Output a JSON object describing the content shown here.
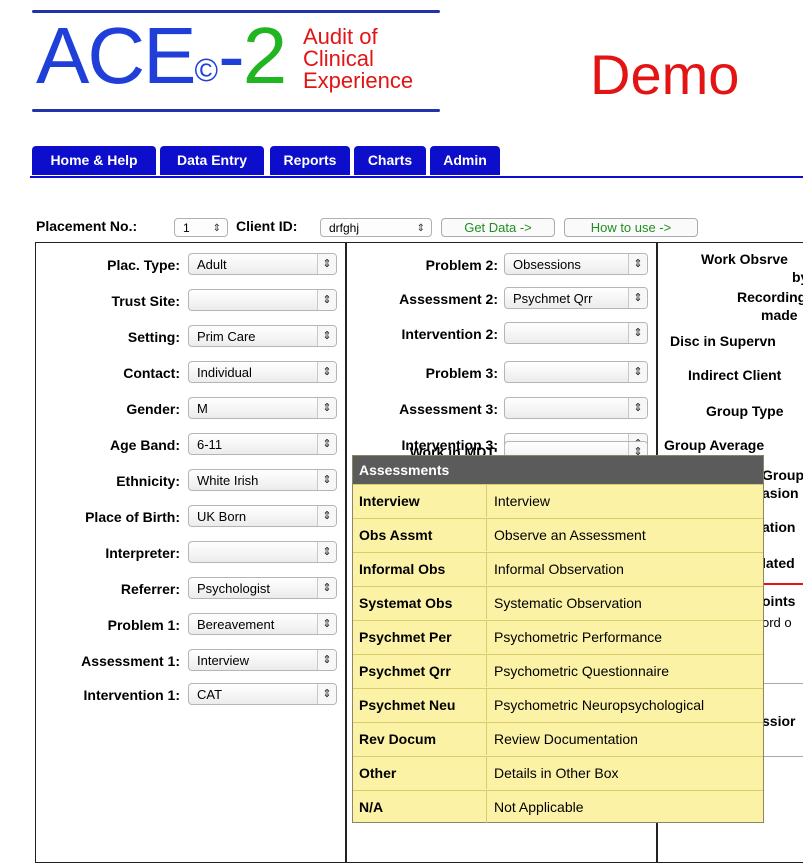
{
  "header": {
    "logo_main": "ACE",
    "logo_copyright": "©",
    "logo_dash": "-",
    "logo_number": "2",
    "logo_tagline": [
      "Audit of",
      "Clinical",
      "Experience"
    ],
    "demo_label": "Demo",
    "colors": {
      "blue": "#1f3fd8",
      "green": "#22b522",
      "red": "#e21414",
      "nav": "#0d0dcc"
    }
  },
  "nav": {
    "tabs": [
      "Home & Help",
      "Data Entry",
      "Reports",
      "Charts",
      "Admin"
    ]
  },
  "controls": {
    "placement_label": "Placement No.:",
    "placement_value": "1",
    "client_label": "Client ID:",
    "client_value": "drfghj",
    "get_data_button": "Get Data ->",
    "how_to_use_button": "How to use ->"
  },
  "left_panel": {
    "fields": [
      {
        "label": "Plac. Type:",
        "value": "Adult"
      },
      {
        "label": "Trust Site:",
        "value": ""
      },
      {
        "label": "Setting:",
        "value": "Prim Care"
      },
      {
        "label": "Contact:",
        "value": "Individual"
      },
      {
        "label": "Gender:",
        "value": "M"
      },
      {
        "label": "Age Band:",
        "value": "6-11"
      },
      {
        "label": "Ethnicity:",
        "value": "White Irish"
      },
      {
        "label": "Place of Birth:",
        "value": "UK Born"
      },
      {
        "label": "Interpreter:",
        "value": ""
      },
      {
        "label": "Referrer:",
        "value": "Psychologist"
      },
      {
        "label": "Problem 1:",
        "value": "Bereavement"
      },
      {
        "label": "Assessment 1:",
        "value": "Interview"
      },
      {
        "label": "Intervention 1:",
        "value": "CAT"
      }
    ]
  },
  "middle_panel": {
    "fields": [
      {
        "label": "Problem 2:",
        "value": "Obsessions"
      },
      {
        "label": "Assessment 2:",
        "value": "Psychmet Qrr"
      },
      {
        "label": "Intervention 2:",
        "value": ""
      },
      {
        "label": "Problem 3:",
        "value": ""
      },
      {
        "label": "Assessment 3:",
        "value": ""
      },
      {
        "label": "Intervention 3:",
        "value": ""
      },
      {
        "label": "Work in MDT:",
        "value": ""
      }
    ]
  },
  "right_panel": {
    "labels": [
      "Work Obsrve",
      "by",
      "Recordings",
      "made",
      "Disc in Supervn",
      "Indirect Client",
      "Group Type",
      "Group Average",
      "Group",
      "asion",
      "ation",
      "lated",
      "oints",
      "ord o",
      "ssior"
    ]
  },
  "popup": {
    "title": "Assessments",
    "rows": [
      {
        "code": "Interview",
        "desc": "Interview"
      },
      {
        "code": "Obs Assmt",
        "desc": "Observe an Assessment"
      },
      {
        "code": "Informal Obs",
        "desc": "Informal Observation"
      },
      {
        "code": "Systemat Obs",
        "desc": "Systematic Observation"
      },
      {
        "code": "Psychmet Per",
        "desc": "Psychometric Performance"
      },
      {
        "code": "Psychmet Qrr",
        "desc": "Psychometric Questionnaire"
      },
      {
        "code": "Psychmet Neu",
        "desc": "Psychometric Neuropsychological"
      },
      {
        "code": "Rev Docum",
        "desc": "Review Documentation"
      },
      {
        "code": "Other",
        "desc": "Details in Other Box"
      },
      {
        "code": "N/A",
        "desc": "Not Applicable"
      }
    ]
  }
}
